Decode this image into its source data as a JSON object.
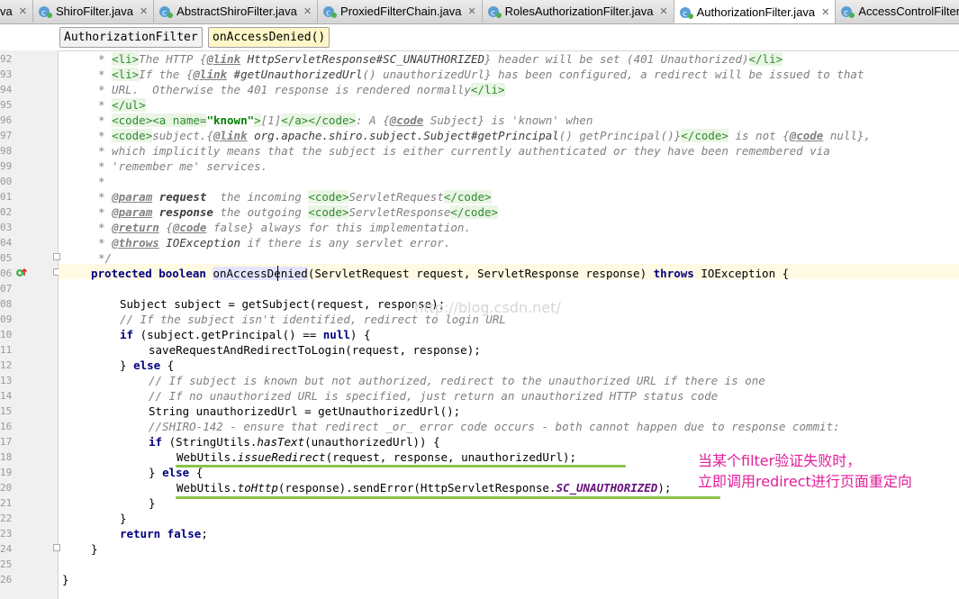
{
  "tabs": [
    {
      "label": "va",
      "active": false,
      "first": true
    },
    {
      "label": "ShiroFilter.java",
      "active": false
    },
    {
      "label": "AbstractShiroFilter.java",
      "active": false
    },
    {
      "label": "ProxiedFilterChain.java",
      "active": false
    },
    {
      "label": "RolesAuthorizationFilter.java",
      "active": false
    },
    {
      "label": "AuthorizationFilter.java",
      "active": true
    },
    {
      "label": "AccessControlFilter",
      "active": false
    }
  ],
  "breadcrumb": {
    "class_name": "AuthorizationFilter",
    "method_name": "onAccessDenied()"
  },
  "line_numbers": [
    "92",
    "93",
    "94",
    "95",
    "96",
    "97",
    "98",
    "99",
    "00",
    "01",
    "02",
    "03",
    "04",
    "05",
    "06",
    "07",
    "08",
    "09",
    "10",
    "11",
    "12",
    "13",
    "14",
    "15",
    "16",
    "17",
    "18",
    "19",
    "20",
    "21",
    "22",
    "23",
    "24",
    "25",
    "26"
  ],
  "code": {
    "l92": {
      "pre": "* ",
      "a": "<li>",
      "b": "The HTTP {",
      "c": "@link",
      "d": " HttpServletResponse",
      "e": "#SC_UNAUTHORIZED",
      "f": "} header will be set (401 Unauthorized)",
      "g": "</li>"
    },
    "l93": {
      "pre": "* ",
      "a": "<li>",
      "b": "If the {",
      "c": "@link",
      "d": " #getUnauthorizedUrl",
      "e": "() unauthorizedUrl} has been configured, a redirect will be issued to that"
    },
    "l94": {
      "a": "* URL.  Otherwise the 401 response is rendered normally",
      "b": "</li>"
    },
    "l95": {
      "pre": "* ",
      "a": "</ul>"
    },
    "l96": {
      "pre": "* ",
      "a": "<code>",
      "b": "<a name=",
      "c": "\"known\"",
      "d": ">",
      "e": "[1]",
      "f": "</a></code>",
      "g": ": A {",
      "h": "@code",
      "i": " Subject} is 'known' when"
    },
    "l97": {
      "pre": "* ",
      "a": "<code>",
      "b": "subject.{",
      "c": "@link",
      "d": " org.apache.shiro.subject.Subject",
      "e": "#getPrincipal",
      "f": "() getPrincipal()}",
      "g": "</code>",
      "h": " is not {",
      "i": "@code",
      "j": " null},"
    },
    "l98": {
      "a": "* which implicitly means that the subject is either currently authenticated or they have been remembered via"
    },
    "l99": {
      "a": "* 'remember me' services."
    },
    "l00": {
      "a": "*"
    },
    "l01": {
      "pre": "* ",
      "a": "@param",
      "b": " request",
      "c": "  the incoming ",
      "d": "<code>",
      "e": "ServletRequest",
      "f": "</code>"
    },
    "l02": {
      "pre": "* ",
      "a": "@param",
      "b": " response",
      "c": " the outgoing ",
      "d": "<code>",
      "e": "ServletResponse",
      "f": "</code>"
    },
    "l03": {
      "pre": "* ",
      "a": "@return",
      "b": " {",
      "c": "@code",
      "d": " false} always for this implementation."
    },
    "l04": {
      "pre": "* ",
      "a": "@throws",
      "b": " IOException",
      "c": " if there is any servlet error."
    },
    "l05": {
      "a": "*/"
    },
    "l06": {
      "a": "protected boolean ",
      "b": "onAccessDenied",
      "c": "(ServletRequest request, ServletResponse response) ",
      "d": "throws",
      "e": " IOException {"
    },
    "l08": {
      "a": "Subject subject = getSubject(request, response);"
    },
    "l09": {
      "a": "// If the subject isn't identified, redirect to login URL"
    },
    "l10": {
      "a": "if",
      "b": " (subject.getPrincipal() == ",
      "c": "null",
      "d": ") {"
    },
    "l11": {
      "a": "saveRequestAndRedirectToLogin(request, response);"
    },
    "l12": {
      "a": "} ",
      "b": "else",
      "c": " {"
    },
    "l13": {
      "a": "// If subject is known but not authorized, redirect to the unauthorized URL if there is one"
    },
    "l14": {
      "a": "// If no unauthorized URL is specified, just return an unauthorized HTTP status code"
    },
    "l15": {
      "a": "String unauthorizedUrl = getUnauthorizedUrl();"
    },
    "l16": {
      "a": "//SHIRO-142 - ensure that redirect _or_ error code occurs - both cannot happen due to response commit:"
    },
    "l17": {
      "a": "if",
      "b": " (StringUtils.",
      "c": "hasText",
      "d": "(unauthorizedUrl)) {"
    },
    "l18": {
      "a": "WebUtils.",
      "b": "issueRedirect",
      "c": "(request, response, unauthorizedUrl);"
    },
    "l19": {
      "a": "} ",
      "b": "else",
      "c": " {"
    },
    "l20": {
      "a": "WebUtils.",
      "b": "toHttp",
      "c": "(response).sendError(HttpServletResponse.",
      "d": "SC_UNAUTHORIZED",
      "e": ");"
    },
    "l21": {
      "a": "}"
    },
    "l22": {
      "a": "}"
    },
    "l23": {
      "a": "return false",
      "b": ";"
    },
    "l24": {
      "a": "}"
    },
    "l26": {
      "a": "}"
    }
  },
  "annotation": {
    "line1": "当某个filter验证失败时，",
    "line2": "立即调用redirect进行页面重定向"
  },
  "watermark": "http://blog.csdn.net/",
  "colors": {
    "keyword": "#000080",
    "comment": "#808080",
    "annotation": "#e01e9a",
    "underline": "#8bc34a",
    "string": "#008000"
  }
}
